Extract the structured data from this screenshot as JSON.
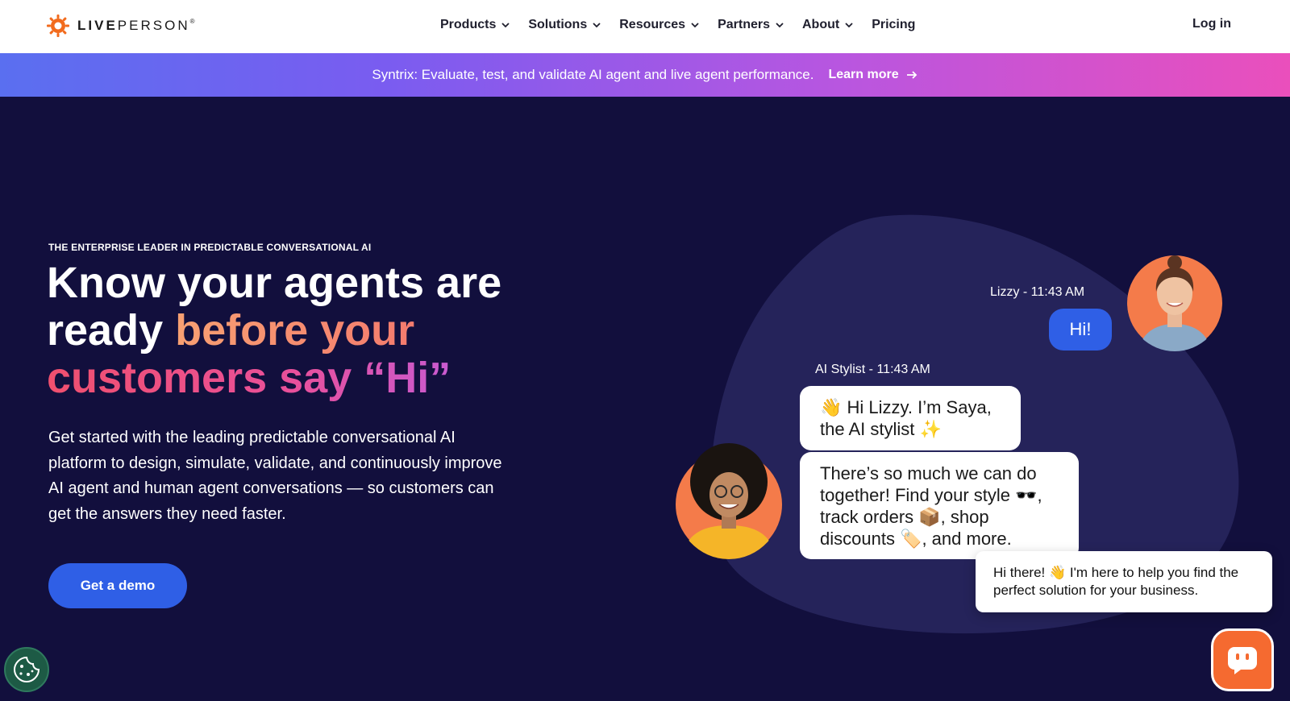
{
  "header": {
    "logo_text_bold": "LIVE",
    "logo_text_light": "PERSON",
    "logo_reg": "®",
    "nav": [
      {
        "label": "Products",
        "has_dropdown": true
      },
      {
        "label": "Solutions",
        "has_dropdown": true
      },
      {
        "label": "Resources",
        "has_dropdown": true
      },
      {
        "label": "Partners",
        "has_dropdown": true
      },
      {
        "label": "About",
        "has_dropdown": true
      },
      {
        "label": "Pricing",
        "has_dropdown": false
      }
    ],
    "login_label": "Log in"
  },
  "banner": {
    "text": "Syntrix: Evaluate, test, and validate AI agent and live agent performance.",
    "link_label": "Learn more"
  },
  "hero": {
    "eyebrow": "THE ENTERPRISE LEADER IN PREDICTABLE CONVERSATIONAL AI",
    "headline_part1": "Know your agents are ready ",
    "headline_orange": "before your",
    "headline_pink": "customers say “Hi”",
    "subtext": "Get started with the leading predictable conversational AI platform to design, simulate, validate, and continuously improve AI agent and human agent conversations — so customers can get the answers they need faster.",
    "cta_label": "Get a demo"
  },
  "illustration": {
    "user_meta": "Lizzy - 11:43 AM",
    "user_message": "Hi!",
    "bot_meta": "AI Stylist - 11:43 AM",
    "bot_message_1": "👋 Hi Lizzy. I’m Saya, the AI stylist ✨",
    "bot_message_2": "There’s so much we can do together! Find your style 🕶️, track orders 📦, shop discounts 🏷️, and more."
  },
  "chat_widget": {
    "popup_text": "Hi there! 👋 I'm here to help you find the perfect solution for your business."
  },
  "colors": {
    "background": "#120f3d",
    "accent_blue": "#2f5fe6",
    "brand_orange": "#f56a30",
    "blob": "#25235a"
  }
}
